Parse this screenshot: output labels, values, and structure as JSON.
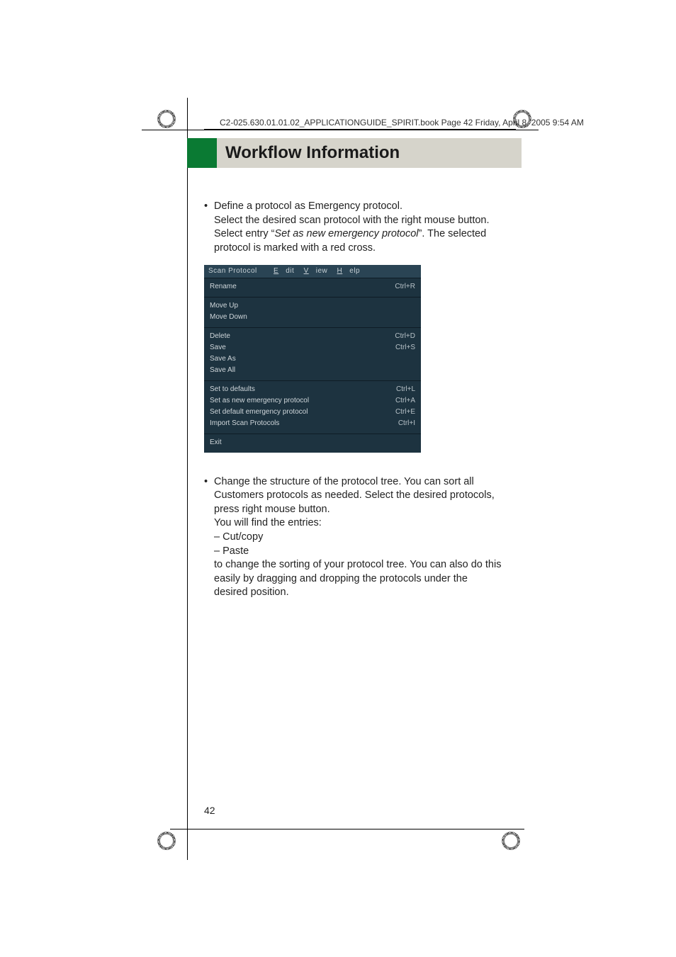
{
  "header": {
    "line": "C2-025.630.01.01.02_APPLICATIONGUIDE_SPIRIT.book  Page 42  Friday, April 8, 2005  9:54 AM"
  },
  "chapter": {
    "title": "Workflow Information"
  },
  "body": {
    "bullet1": {
      "line1": "Define a protocol as Emergency protocol.",
      "line2a": "Select the desired scan protocol with the right mouse button. Select entry “",
      "line2_em": "Set as new emergency protocol",
      "line2b": "”. The selected protocol is marked with a red cross."
    },
    "bullet2": {
      "p1": "Change the structure of the protocol tree. You can sort all Customers protocols as needed. Select the desired protocols, press right mouse button.",
      "p2": "You will find the entries:",
      "dash1": "– Cut/copy",
      "dash2": "– Paste",
      "p3": "to change the sorting of your protocol tree. You can also do this easily by dragging and dropping the protocols under the desired position."
    }
  },
  "menu": {
    "bar": {
      "scan": "Scan Protocol",
      "edit": "Edit",
      "view": "View",
      "help": "Help"
    },
    "g1": {
      "rename": "Rename",
      "rename_sc": "Ctrl+R"
    },
    "g2": {
      "moveup": "Move Up",
      "movedown": "Move Down"
    },
    "g3": {
      "delete": "Delete",
      "delete_sc": "Ctrl+D",
      "save": "Save",
      "save_sc": "Ctrl+S",
      "saveas": "Save As",
      "saveall": "Save All"
    },
    "g4": {
      "defaults": "Set to defaults",
      "defaults_sc": "Ctrl+L",
      "newem": "Set as new emergency protocol",
      "newem_sc": "Ctrl+A",
      "defem": "Set default emergency protocol",
      "defem_sc": "Ctrl+E",
      "import": "Import Scan Protocols",
      "import_sc": "Ctrl+I"
    },
    "g5": {
      "exit": "Exit"
    }
  },
  "page_number": "42"
}
